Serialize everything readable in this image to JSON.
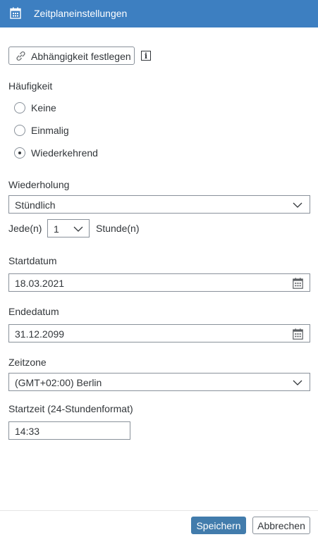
{
  "header": {
    "title": "Zeitplaneinstellungen",
    "icon": "calendar-icon"
  },
  "dependency": {
    "button_label": "Abhängigkeit festlegen",
    "icon": "link-icon",
    "info_icon": "info-icon",
    "info_glyph": "i"
  },
  "frequency": {
    "label": "Häufigkeit",
    "options": [
      {
        "label": "Keine",
        "checked": false
      },
      {
        "label": "Einmalig",
        "checked": false
      },
      {
        "label": "Wiederkehrend",
        "checked": true
      }
    ]
  },
  "repetition": {
    "label": "Wiederholung",
    "value": "Stündlich",
    "every_prefix": "Jede(n)",
    "every_value": "1",
    "every_suffix": "Stunde(n)"
  },
  "start_date": {
    "label": "Startdatum",
    "value": "18.03.2021"
  },
  "end_date": {
    "label": "Endedatum",
    "value": "31.12.2099"
  },
  "timezone": {
    "label": "Zeitzone",
    "value": "(GMT+02:00) Berlin"
  },
  "start_time": {
    "label": "Startzeit (24-Stundenformat)",
    "value": "14:33"
  },
  "footer": {
    "save_label": "Speichern",
    "cancel_label": "Abbrechen"
  },
  "colors": {
    "header_bg": "#3d7fc1",
    "primary_button": "#427cac",
    "border": "#89919a",
    "text": "#32363a"
  }
}
